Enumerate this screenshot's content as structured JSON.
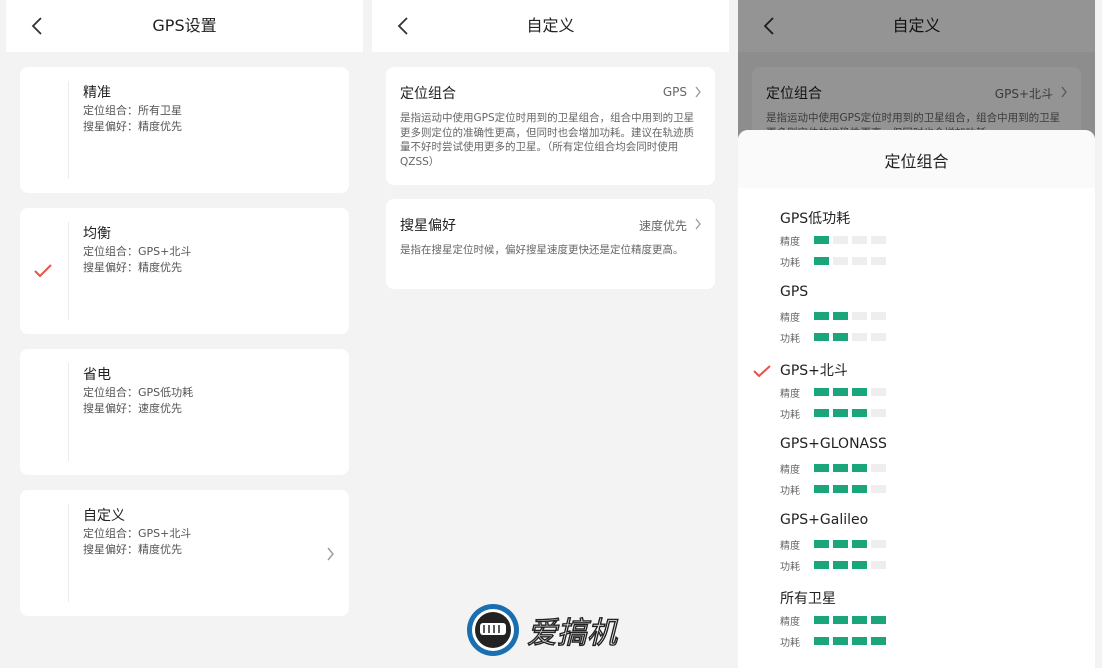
{
  "screen1": {
    "title": "GPS设置",
    "cards": [
      {
        "title": "精准",
        "line1": "定位组合：所有卫星",
        "line2": "搜星偏好：精度优先",
        "checked": false,
        "chevron": false
      },
      {
        "title": "均衡",
        "line1": "定位组合：GPS+北斗",
        "line2": "搜星偏好：精度优先",
        "checked": true,
        "chevron": false
      },
      {
        "title": "省电",
        "line1": "定位组合：GPS低功耗",
        "line2": "搜星偏好：速度优先",
        "checked": false,
        "chevron": false
      },
      {
        "title": "自定义",
        "line1": "定位组合：GPS+北斗",
        "line2": "搜星偏好：精度优先",
        "checked": false,
        "chevron": true
      }
    ]
  },
  "screen2": {
    "title": "自定义",
    "settings": [
      {
        "label": "定位组合",
        "value": "GPS",
        "description": "是指运动中使用GPS定位时用到的卫星组合，组合中用到的卫星更多则定位的准确性更高，但同时也会增加功耗。建议在轨迹质量不好时尝试使用更多的卫星。（所有定位组合均会同时使用QZSS）"
      },
      {
        "label": "搜星偏好",
        "value": "速度优先",
        "description": "是指在搜星定位时候，偏好搜星速度更快还是定位精度更高。"
      }
    ]
  },
  "screen3": {
    "title": "自定义",
    "bg_setting_label": "定位组合",
    "bg_setting_value": "GPS+北斗",
    "bg_setting_desc": "是指运动中使用GPS定位时用到的卫星组合，组合中用到的卫星更多则定位的准确性更高，但同时也会增加功耗。",
    "sheet_title": "定位组合",
    "accuracy_label": "精度",
    "power_label": "功耗",
    "options": [
      {
        "name": "GPS低功耗",
        "accuracy": 1,
        "power": 1,
        "checked": false
      },
      {
        "name": "GPS",
        "accuracy": 2,
        "power": 2,
        "checked": false
      },
      {
        "name": "GPS+北斗",
        "accuracy": 3,
        "power": 3,
        "checked": true
      },
      {
        "name": "GPS+GLONASS",
        "accuracy": 3,
        "power": 3,
        "checked": false
      },
      {
        "name": "GPS+Galileo",
        "accuracy": 3,
        "power": 3,
        "checked": false
      },
      {
        "name": "所有卫星",
        "accuracy": 4,
        "power": 4,
        "checked": false
      }
    ],
    "bar_max": 4
  },
  "watermark": {
    "text": "爱搞机"
  },
  "colors": {
    "accent_check": "#e8524a",
    "bar_on": "#1aa57a",
    "bar_off": "#eeeeee",
    "card_bg": "#ffffff",
    "page_bg": "#f3f3f3"
  }
}
